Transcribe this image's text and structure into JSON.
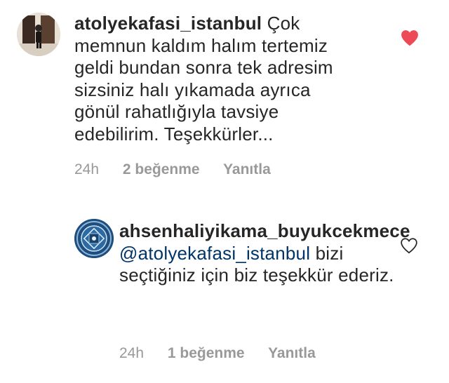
{
  "comments": [
    {
      "username": "atolyekafasi_istanbul",
      "text": "Çok memnun kaldım halım tertemiz geldi bundan sonra tek adresim sizsiniz halı yıkamada ayrıca gönül rahatlığıyla tavsiye edebilirim. Teşekkürler...",
      "time": "24h",
      "likes": "2 beğenme",
      "reply": "Yanıtla",
      "liked": true,
      "heart_color": "#ed4956",
      "avatar": "person-photo-avatar"
    },
    {
      "username": "ahsenhaliyikama_buyukcekmece",
      "mention": "@atolyekafasi_istanbul",
      "text": "bizi seçtiğiniz için biz teşekkür ederiz.",
      "time": "24h",
      "likes": "1 beğenme",
      "reply": "Yanıtla",
      "liked": false,
      "avatar": "ornamental-logo-avatar"
    }
  ]
}
